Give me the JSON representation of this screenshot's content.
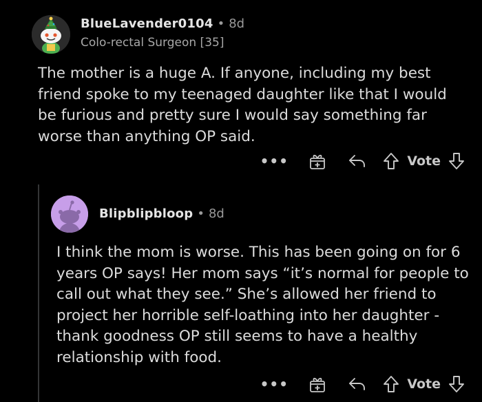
{
  "comments": [
    {
      "username": "BlueLavender0104",
      "separator": "•",
      "age": "8d",
      "flair": "Colo-rectal Surgeon [35]",
      "body": "The mother is a huge A. If anyone, including my best friend spoke to my teenaged daughter like that I would be furious and pretty sure I would say something far worse than anything OP said.",
      "actions": {
        "more_label": "•••",
        "vote_label": "Vote"
      }
    },
    {
      "username": "Blipblipbloop",
      "separator": "•",
      "age": "8d",
      "body": "I think the mom is worse. This has been going on for 6 years OP says! Her mom says “it’s normal for people to call out what they see.” She’s allowed her friend to project her horrible self-loathing into her daughter - thank goodness OP still seems to have a healthy relationship with food.",
      "actions": {
        "more_label": "•••",
        "vote_label": "Vote"
      }
    }
  ],
  "icons": [
    "snoo-avatar-icon",
    "more-options-icon",
    "award-icon",
    "reply-icon",
    "upvote-icon",
    "downvote-icon"
  ],
  "colors": {
    "background": "#000000",
    "text": "#dcdcdc",
    "muted": "#9a9a9a",
    "avatar2_bg": "#c79ee9"
  }
}
